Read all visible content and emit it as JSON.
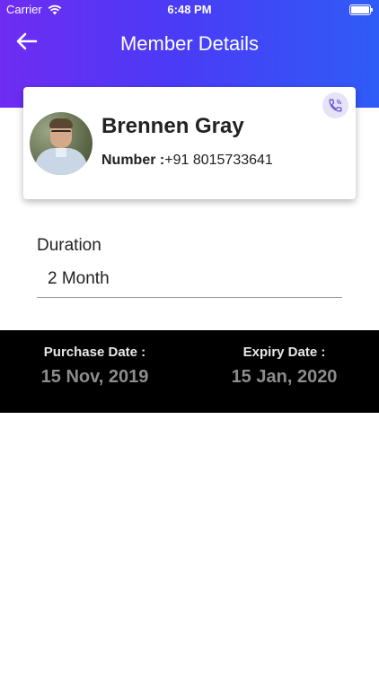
{
  "status_bar": {
    "carrier": "Carrier",
    "time": "6:48 PM"
  },
  "header": {
    "title": "Member Details",
    "back_icon": "arrow-left-icon"
  },
  "member": {
    "name": "Brennen Gray",
    "number_label": "Number :",
    "number_value": "+91 8015733641",
    "call_icon": "phone-icon"
  },
  "duration": {
    "label": "Duration",
    "value": "2 Month"
  },
  "dates": {
    "purchase_label": "Purchase Date :",
    "purchase_value": "15 Nov, 2019",
    "expiry_label": "Expiry Date :",
    "expiry_value": "15 Jan, 2020"
  },
  "colors": {
    "header_gradient_start": "#6f2cf2",
    "header_gradient_end": "#2f5cf6",
    "date_bar_bg": "#000000",
    "date_value": "#8c8c8c"
  }
}
